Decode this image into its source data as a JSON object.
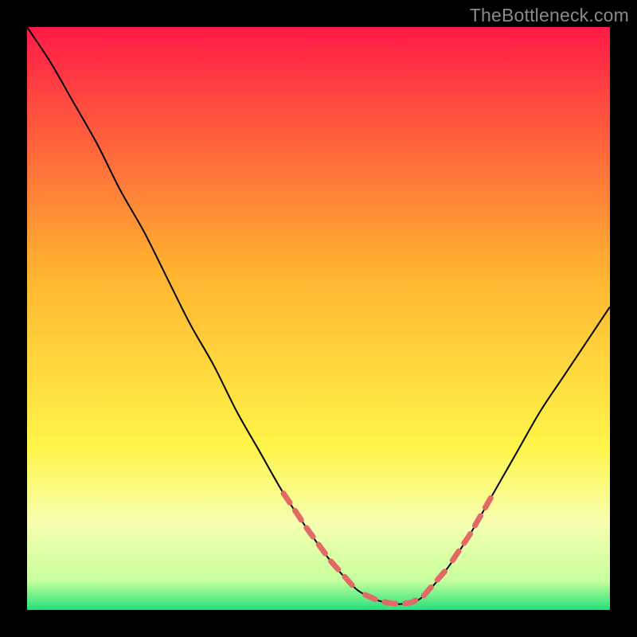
{
  "watermark": "TheBottleneck.com",
  "colors": {
    "bg": "#000000",
    "top": "#ff1a47",
    "mid": "#ffb330",
    "low": "#fff54a",
    "pale": "#f7ffb0",
    "bottom": "#24e07a",
    "curve": "#000000",
    "dash": "#e26a66"
  },
  "chart_data": {
    "type": "line",
    "title": "",
    "xlabel": "",
    "ylabel": "",
    "xlim": [
      0,
      100
    ],
    "ylim": [
      0,
      100
    ],
    "series": [
      {
        "name": "bottleneck-curve",
        "x": [
          0,
          4,
          8,
          12,
          16,
          20,
          24,
          28,
          32,
          36,
          40,
          44,
          48,
          52,
          56,
          58,
          60,
          62,
          64,
          66,
          68,
          72,
          76,
          80,
          84,
          88,
          92,
          96,
          100
        ],
        "y": [
          100,
          94,
          87,
          80,
          72,
          65,
          57,
          49,
          42,
          34,
          27,
          20,
          14,
          8.5,
          4.0,
          2.6,
          1.7,
          1.2,
          1.0,
          1.3,
          2.4,
          7,
          13,
          20,
          27,
          34,
          40,
          46,
          52
        ]
      }
    ],
    "highlight_ranges_x": [
      [
        44,
        56
      ],
      [
        58,
        72
      ],
      [
        73,
        80
      ]
    ],
    "gradient_stops": [
      {
        "pct": 0,
        "color": "#ff1a47"
      },
      {
        "pct": 42,
        "color": "#ffb330"
      },
      {
        "pct": 72,
        "color": "#fff54a"
      },
      {
        "pct": 85,
        "color": "#f7ffb0"
      },
      {
        "pct": 95,
        "color": "#c7ff9e"
      },
      {
        "pct": 100,
        "color": "#24e07a"
      }
    ]
  }
}
